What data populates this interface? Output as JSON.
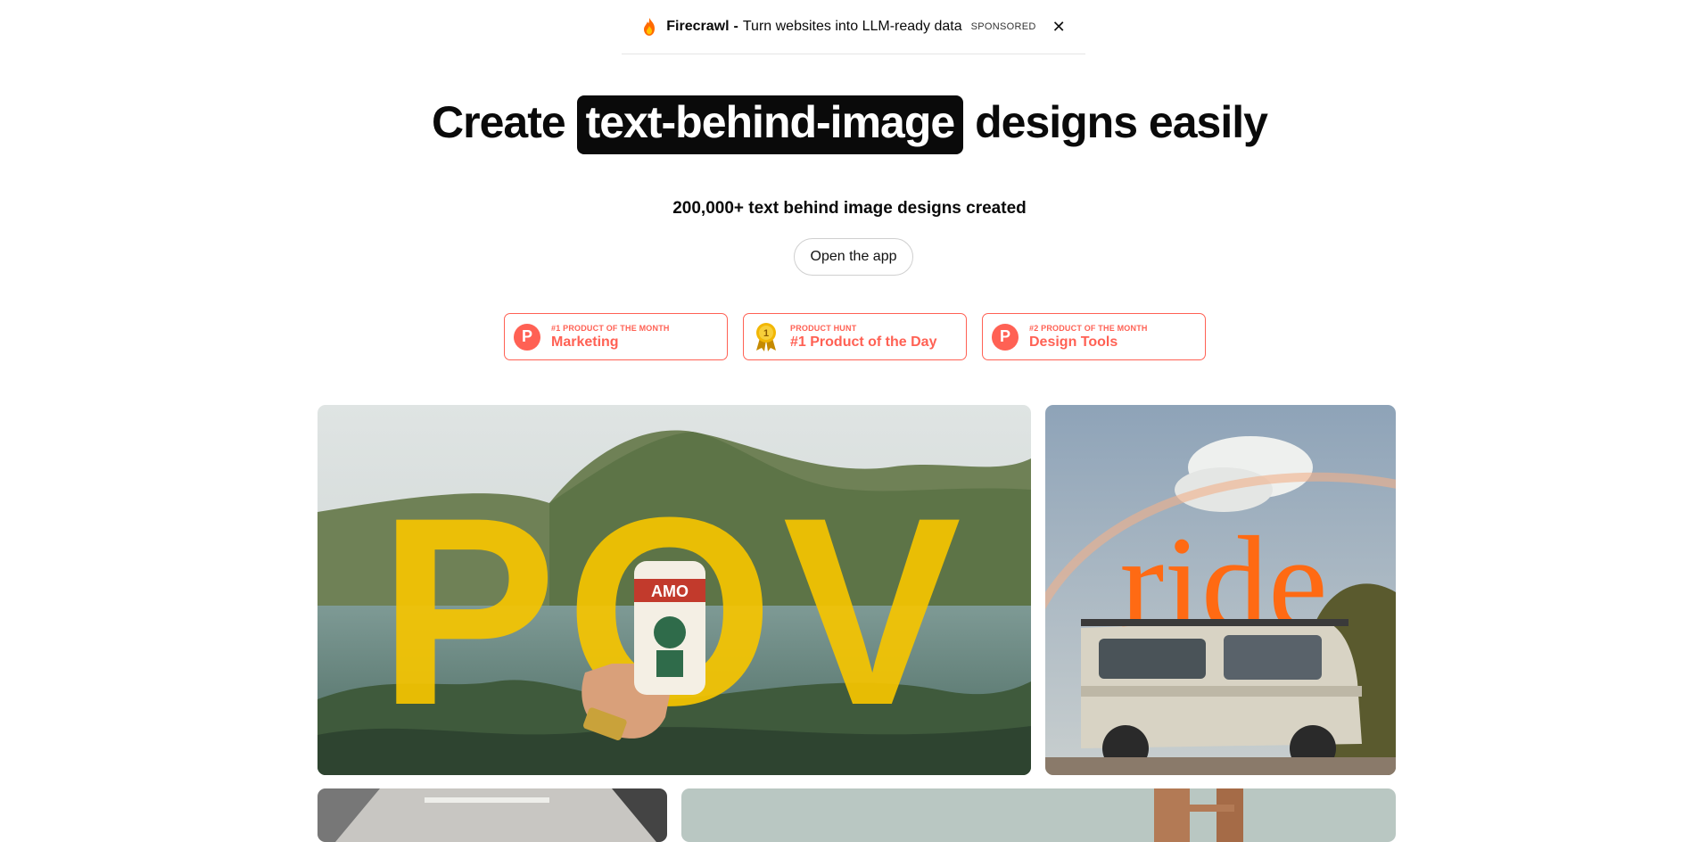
{
  "sponsor": {
    "brand": "Firecrawl",
    "separator": "-",
    "text": "Turn websites into LLM-ready data",
    "tag": "SPONSORED",
    "close": "✕"
  },
  "hero": {
    "prefix": "Create",
    "highlight": "text-behind-image",
    "suffix": "designs easily"
  },
  "subtitle": "200,000+ text behind image designs created",
  "cta": {
    "label": "Open the app"
  },
  "badges": [
    {
      "small": "#1 Product of the Month",
      "big": "Marketing",
      "icon": "product-hunt-icon"
    },
    {
      "small": "Product Hunt",
      "big": "#1 Product of the Day",
      "icon": "medal-icon"
    },
    {
      "small": "#2 Product of the Month",
      "big": "Design Tools",
      "icon": "product-hunt-icon"
    }
  ],
  "gallery": [
    {
      "overlay_text": "POV",
      "color": "#f5c400"
    },
    {
      "overlay_text": "ride",
      "color": "#ff6a13"
    }
  ]
}
